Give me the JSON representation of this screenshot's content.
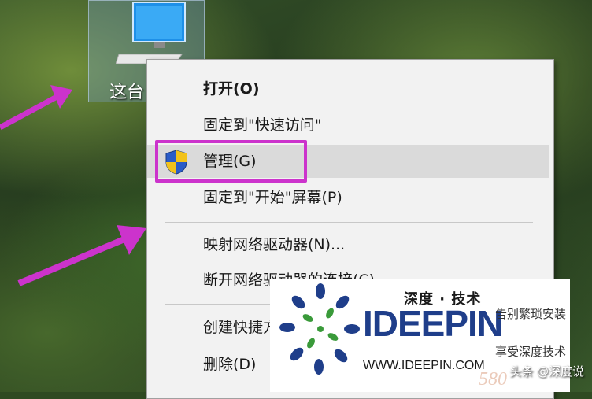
{
  "desktop": {
    "icon_label": "这台",
    "icon_name": "monitor-icon"
  },
  "context_menu": {
    "items": [
      {
        "label": "打开(O)",
        "bold": true
      },
      {
        "label": "固定到\"快速访问\""
      },
      {
        "label": "管理(G)",
        "icon": "uac-shield-icon",
        "highlighted": true
      },
      {
        "label": "固定到\"开始\"屏幕(P)"
      },
      {
        "label": "映射网络驱动器(N)..."
      },
      {
        "label": "断开网络驱动器的连接(C)..."
      },
      {
        "label": "创建快捷方式(S)"
      },
      {
        "label": "删除(D)"
      }
    ]
  },
  "annotation": {
    "highlight_color": "#cc33cc",
    "arrow_color": "#cc33cc"
  },
  "watermark": {
    "brand_cn": "深度 · 技术",
    "brand": "IDEEPIN",
    "slogan_1": "告别繁琐安装",
    "slogan_2": "享受深度技术",
    "url": "WWW.IDEEPIN.COM",
    "brand_color": "#1f3e8a"
  },
  "corner": {
    "tag": "头条 @深度说",
    "site": "580"
  }
}
